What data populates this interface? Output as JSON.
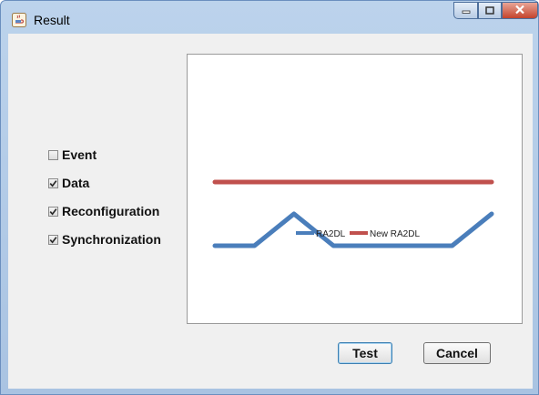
{
  "window": {
    "title": "Result",
    "app_icon": "java-icon"
  },
  "checkboxes": [
    {
      "label": "Event",
      "checked": false
    },
    {
      "label": "Data",
      "checked": true
    },
    {
      "label": "Reconfiguration",
      "checked": true
    },
    {
      "label": "Synchronization",
      "checked": true
    }
  ],
  "buttons": {
    "test": "Test",
    "cancel": "Cancel"
  },
  "colors": {
    "series1": "#4a7ebb",
    "series2": "#c0504d"
  },
  "chart_data": {
    "type": "line",
    "x": [
      1,
      2,
      3,
      4,
      5,
      6,
      7,
      8
    ],
    "ylim": [
      0,
      10
    ],
    "grid": false,
    "legend": "bottom-center",
    "series": [
      {
        "name": "RA2DL",
        "values": [
          4,
          4,
          5,
          4,
          4,
          4,
          4,
          5
        ]
      },
      {
        "name": "New RA2DL",
        "values": [
          6,
          6,
          6,
          6,
          6,
          6,
          6,
          6
        ]
      }
    ]
  }
}
